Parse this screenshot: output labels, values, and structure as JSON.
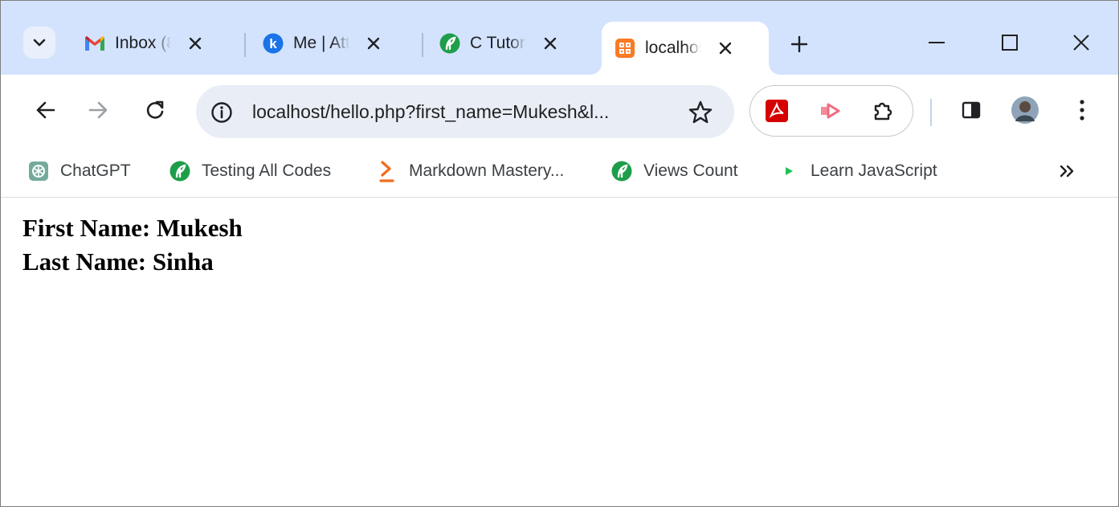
{
  "tabs": [
    {
      "title": "Inbox (8",
      "favicon": "gmail-icon",
      "active": false
    },
    {
      "title": "Me | Att",
      "favicon": "k-circle-icon",
      "active": false
    },
    {
      "title": "C Tutori",
      "favicon": "green-leaf-icon",
      "active": false
    },
    {
      "title": "localhos",
      "favicon": "xampp-icon",
      "active": true
    }
  ],
  "address_bar": {
    "url": "localhost/hello.php?first_name=Mukesh&l..."
  },
  "bookmarks": [
    {
      "label": "ChatGPT",
      "icon": "chatgpt-icon"
    },
    {
      "label": "Testing All Codes",
      "icon": "green-leaf-icon"
    },
    {
      "label": "Markdown Mastery...",
      "icon": "orange-chevron-icon"
    },
    {
      "label": "Views Count",
      "icon": "green-leaf-icon"
    },
    {
      "label": "Learn JavaScript",
      "icon": "green-play-icon"
    }
  ],
  "page": {
    "first_name_line": "First Name: Mukesh",
    "last_name_line": "Last Name: Sinha"
  },
  "colors": {
    "tabstrip_bg": "#d3e3fd",
    "omnibox_bg": "#e9eef6",
    "active_tab_bg": "#ffffff"
  }
}
